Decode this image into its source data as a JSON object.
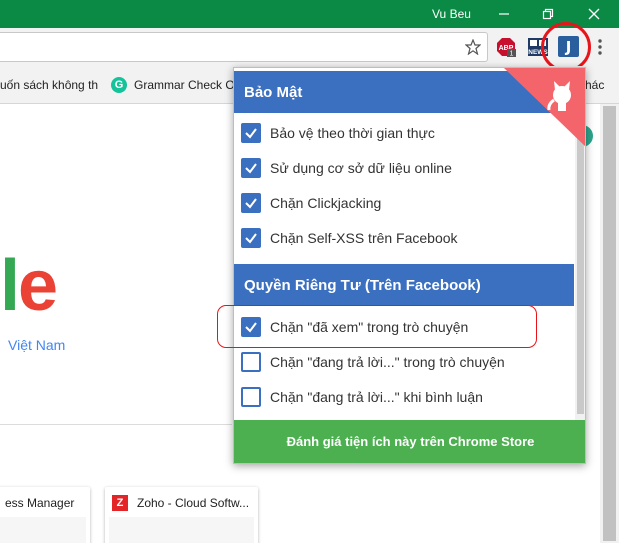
{
  "window": {
    "user_name": "Vu Beu",
    "controls": [
      "minimize",
      "maximize",
      "close"
    ]
  },
  "toolbar": {
    "icons": [
      "star-icon",
      "adblock-plus-icon",
      "news-extension-icon",
      "j2team-extension-icon",
      "menu-icon"
    ],
    "abp_badge": "1",
    "news_label": "NEWS",
    "active_extension_letter": "J"
  },
  "bookmarks": {
    "item1": "uốn sách không th",
    "item2_icon": "G",
    "item2": "Grammar Check Or",
    "item3": "hác"
  },
  "page": {
    "logo_letters": [
      "l",
      "e"
    ],
    "region": "Việt Nam",
    "tiles": [
      {
        "label": "ess Manager"
      },
      {
        "icon": "Z",
        "label": "Zoho - Cloud Softw..."
      }
    ]
  },
  "popup": {
    "security": {
      "title": "Bảo Mật",
      "options": [
        {
          "label": "Bảo vệ theo thời gian thực",
          "checked": true
        },
        {
          "label": "Sử dụng cơ sở dữ liệu online",
          "checked": true
        },
        {
          "label": "Chặn Clickjacking",
          "checked": true
        },
        {
          "label": "Chặn Self-XSS trên Facebook",
          "checked": true
        }
      ]
    },
    "privacy": {
      "title": "Quyền Riêng Tư (Trên Facebook)",
      "options": [
        {
          "label": "Chặn \"đã xem\" trong trò chuyện",
          "checked": true
        },
        {
          "label": "Chặn \"đang trả lời...\" trong trò chuyện",
          "checked": false
        },
        {
          "label": "Chặn \"đang trả lời...\" khi bình luận",
          "checked": false
        }
      ]
    },
    "rate_button": "Đánh giá tiện ích này trên Chrome Store"
  },
  "colors": {
    "titlebar": "#0a8a44",
    "section_header": "#3b6fc0",
    "rate_button": "#4caf50",
    "highlight": "#e8141b"
  }
}
